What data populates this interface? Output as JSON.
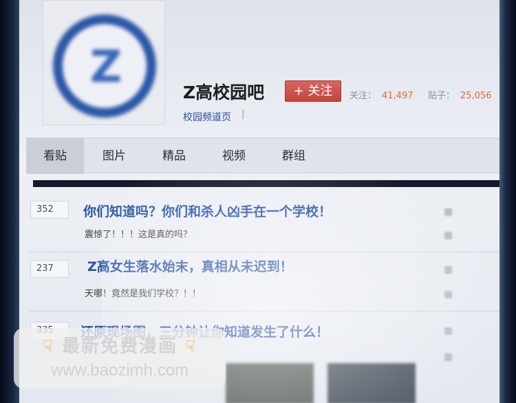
{
  "forum": {
    "name": "Z高校园吧",
    "follow_label": "+ 关注",
    "stats": {
      "followers_label": "关注：",
      "followers_count": "41,497",
      "posts_label": "贴子：",
      "posts_count": "25,056"
    },
    "channel_link": "校园频道页",
    "channel_separator": "|"
  },
  "tabs": [
    {
      "label": "看贴",
      "active": true
    },
    {
      "label": "图片",
      "active": false
    },
    {
      "label": "精品",
      "active": false
    },
    {
      "label": "视频",
      "active": false
    },
    {
      "label": "群组",
      "active": false
    }
  ],
  "threads": [
    {
      "replies": "352",
      "title": "你们知道吗？你们和杀人凶手在一个学校！",
      "abstract": "震惊了！！！这是真的吗？"
    },
    {
      "replies": "237",
      "title": "Z高女生落水始末，真相从未迟到！",
      "abstract": "天哪！竟然是我们学校？！！"
    },
    {
      "replies": "335",
      "title": "还原现场图，三分钟让你知道发生了什么！",
      "abstract": ""
    }
  ],
  "watermark": {
    "line1": "最新免费漫画",
    "line2": "www.baozimh.com",
    "hand_icon": "pointing-hand-icon",
    "hand_color": "#f2a31a"
  },
  "colors": {
    "accent_link": "#2a55a0",
    "follow_button": "#c3443d",
    "stat_number": "#e06a2e"
  }
}
